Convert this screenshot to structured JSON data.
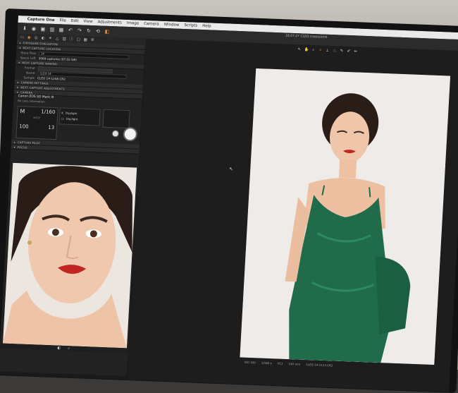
{
  "menubar": {
    "app_name": "Capture One",
    "items": [
      "File",
      "Edit",
      "View",
      "Adjustments",
      "Image",
      "Camera",
      "Window",
      "Scripts",
      "Help"
    ]
  },
  "window_title": "18.07.27 CLEO.cosessionb",
  "toolbar_icons": [
    "import-icon",
    "capture-icon",
    "camera-icon",
    "trash-icon",
    "grid-icon",
    "undo-icon",
    "redo-icon",
    "rotate-icon",
    "reset-icon",
    "copy-icon"
  ],
  "sections": {
    "exposure_evaluation": "EXPOSURE EVALUATION",
    "next_capture_location": "NEXT CAPTURE LOCATION",
    "next_capture_naming": "NEXT CAPTURE NAMING",
    "camera_settings": "CAMERA SETTINGS",
    "next_capture_adjustments": "NEXT CAPTURE ADJUSTMENTS",
    "camera": "CAMERA",
    "capture_pilot": "CAPTURE PILOT",
    "focus": "FOCUS"
  },
  "location": {
    "store_files_label": "Store Files",
    "store_files_value": "14",
    "space_left_label": "Space Left",
    "space_left_value": "3069 captures (97.02 GB)"
  },
  "naming": {
    "format_label": "Format",
    "name_label": "Name",
    "name_value": "CLEO 14-",
    "sample_label": "Sample",
    "sample_value": "CLEO 14-1248.CR2"
  },
  "camera": {
    "model": "Canon EOS 5D Mark III",
    "lens": "No Lens Information",
    "mode": "M",
    "shutter": "1/160",
    "ev": "±0.0",
    "iso": "100",
    "aperture": "13",
    "wb_label": "Daylight",
    "wb_option": "Daylight"
  },
  "status_bar": {
    "iso": "ISO 100",
    "shutter": "1/160 s",
    "aperture": "f/13",
    "focal": "140 mm",
    "file": "CLEO 14-1123.CR2"
  }
}
